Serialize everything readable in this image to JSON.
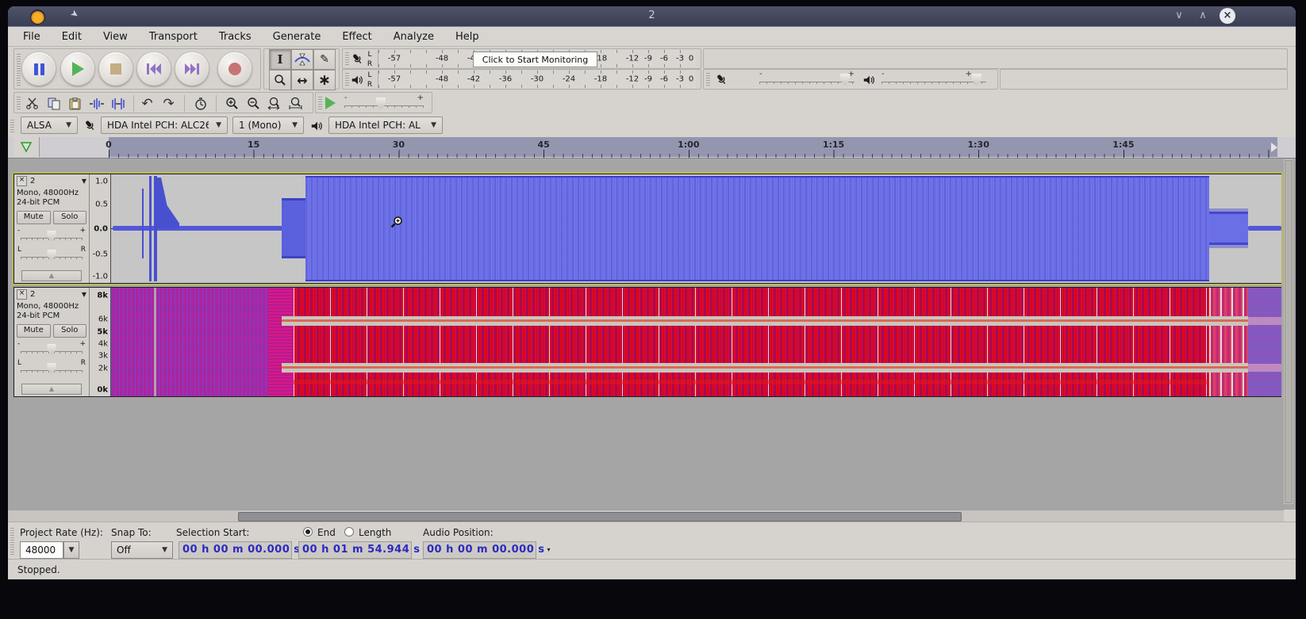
{
  "window": {
    "title": "2"
  },
  "icons": {
    "dropdown": "▾",
    "menu_dropdown": "▼",
    "close": "×",
    "minimize": "∨",
    "maximize": "∧",
    "undo": "↶",
    "redo": "↷",
    "ibeam": "I",
    "pencil": "✎",
    "timeshift": "↔",
    "multitool": "∗",
    "collapse": "▲",
    "pin": "➤"
  },
  "menu": {
    "items": [
      "File",
      "Edit",
      "View",
      "Transport",
      "Tracks",
      "Generate",
      "Effect",
      "Analyze",
      "Help"
    ]
  },
  "meters": {
    "channel_left": "L",
    "channel_right": "R",
    "record_tooltip": "Click to Start Monitoring",
    "ticks": [
      "-57",
      "-48",
      "-42",
      "-36",
      "-30",
      "-24",
      "-18",
      "-12",
      "-9",
      "-6",
      "-3",
      "0"
    ]
  },
  "mixer": {
    "minus": "-",
    "plus": "+"
  },
  "transcription": {
    "minus": "-",
    "plus": "+"
  },
  "device": {
    "host": "ALSA",
    "input_device": "HDA Intel PCH: ALC26",
    "input_channels": "1 (Mono)",
    "output_device": "HDA Intel PCH: AL"
  },
  "timeline": {
    "labels": [
      "0",
      "15",
      "30",
      "45",
      "1:00",
      "1:15",
      "1:30",
      "1:45"
    ]
  },
  "tracks": [
    {
      "name": "2",
      "format_line1": "Mono, 48000Hz",
      "format_line2": "24-bit PCM",
      "mute": "Mute",
      "solo": "Solo",
      "gain_minus": "-",
      "gain_plus": "+",
      "pan_left": "L",
      "pan_right": "R",
      "view": "waveform",
      "ruler": [
        "1.0",
        "0.5",
        "0.0",
        "-0.5",
        "-1.0"
      ]
    },
    {
      "name": "2",
      "format_line1": "Mono, 48000Hz",
      "format_line2": "24-bit PCM",
      "mute": "Mute",
      "solo": "Solo",
      "gain_minus": "-",
      "gain_plus": "+",
      "pan_left": "L",
      "pan_right": "R",
      "view": "spectrogram",
      "ruler": [
        "8k",
        "6k",
        "5k",
        "4k",
        "3k",
        "2k",
        "0k"
      ]
    }
  ],
  "selection_bar": {
    "rate_label": "Project Rate (Hz):",
    "rate_value": "48000",
    "snap_label": "Snap To:",
    "snap_value": "Off",
    "start_label": "Selection Start:",
    "end_radio": "End",
    "length_radio": "Length",
    "audio_label": "Audio Position:",
    "start_value": "00 h 00 m 00.000 s",
    "end_value": "00 h 01 m 54.944 s",
    "audio_value": "00 h 00 m 00.000 s"
  },
  "status": {
    "text": "Stopped."
  },
  "colors": {
    "wave_blue": "#6b6fe6",
    "spectro_base": "#c40950",
    "ruler_selection": "#9496b0",
    "titlebar": "#3a3e52"
  }
}
